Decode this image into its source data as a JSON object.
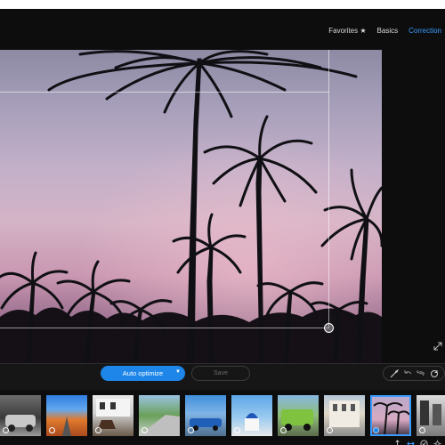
{
  "header": {
    "tabs": [
      {
        "label": "Favorites ★",
        "active": false
      },
      {
        "label": "Basics",
        "active": false
      },
      {
        "label": "Correction",
        "active": true
      }
    ]
  },
  "toolbar": {
    "optimize_label": "Auto optimize",
    "save_label": "Save",
    "tools": [
      "eyedropper-icon",
      "undo-icon",
      "undo-all-icon",
      "reset-icon"
    ]
  },
  "filmstrip": {
    "thumbnails": [
      {
        "subject": "bw-car",
        "checked": false,
        "selected": false
      },
      {
        "subject": "desert-road",
        "checked": false,
        "selected": false
      },
      {
        "subject": "horse-building",
        "checked": false,
        "selected": false
      },
      {
        "subject": "coastal-road",
        "checked": false,
        "selected": false
      },
      {
        "subject": "blue-car",
        "checked": false,
        "selected": false
      },
      {
        "subject": "blue-dome",
        "checked": false,
        "selected": false
      },
      {
        "subject": "green-truck",
        "checked": false,
        "selected": false
      },
      {
        "subject": "building",
        "checked": false,
        "selected": false
      },
      {
        "subject": "palm-trees",
        "checked": true,
        "selected": true
      },
      {
        "subject": "bw-street",
        "checked": false,
        "selected": false
      }
    ]
  },
  "status_icons": [
    "vertical-arrows-icon",
    "horizontal-arrows-icon",
    "check-circle-icon",
    "settings-icon"
  ],
  "colors": {
    "accent": "#1e86e8",
    "active_tab": "#3b9cff",
    "background": "#0d0d0d"
  }
}
